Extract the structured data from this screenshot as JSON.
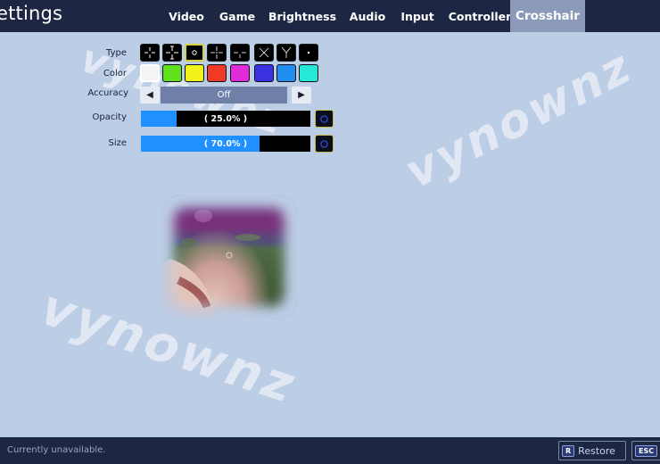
{
  "header": {
    "title": "ettings",
    "tabs": [
      {
        "label": "Video",
        "active": false
      },
      {
        "label": "Game",
        "active": false
      },
      {
        "label": "Brightness",
        "active": false
      },
      {
        "label": "Audio",
        "active": false
      },
      {
        "label": "Input",
        "active": false
      },
      {
        "label": "Controller",
        "active": false
      },
      {
        "label": "Crosshair",
        "active": true
      }
    ]
  },
  "crosshair": {
    "type_label": "Type",
    "color_label": "Color",
    "accuracy_label": "Accuracy",
    "accuracy_value": "Off",
    "opacity_label": "Opacity",
    "opacity_text": "( 25.0% )",
    "opacity_percent": 25,
    "size_label": "Size",
    "size_text": "( 70.0% )",
    "size_percent": 70,
    "types": [
      "crosshair-plus-icon",
      "crosshair-wide-icon",
      "crosshair-circle-icon",
      "crosshair-thin-icon",
      "crosshair-split-icon",
      "crosshair-x-icon",
      "crosshair-y-icon",
      "crosshair-dot-icon"
    ],
    "selected_type_index": 2,
    "colors": [
      "#f4f4f4",
      "#5fe11e",
      "#f2f21b",
      "#ef3a26",
      "#e02bd8",
      "#3a32de",
      "#1f8ef0",
      "#25e8d6"
    ],
    "selected_color_index": 0
  },
  "watermark": {
    "text": "vynownz"
  },
  "footer": {
    "status": "Currently unavailable.",
    "restore_key": "R",
    "restore_label": "Restore",
    "esc_key": "ESC"
  }
}
